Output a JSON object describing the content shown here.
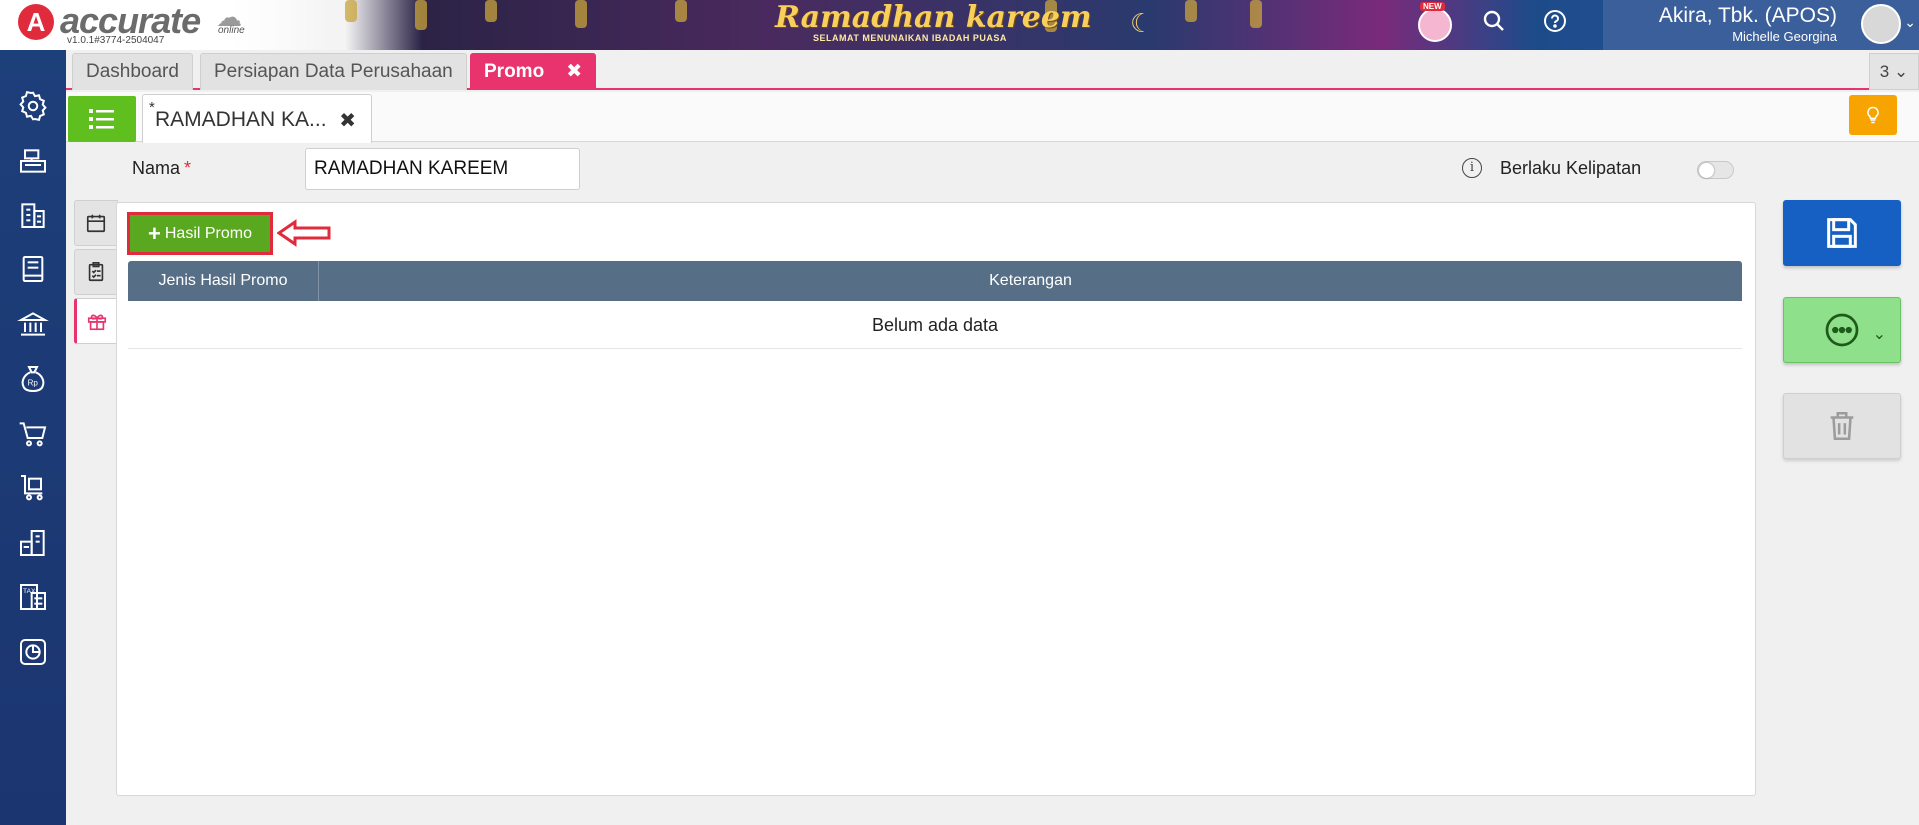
{
  "app": {
    "logo_letter": "A",
    "logo_text": "accurate",
    "logo_online": "online",
    "version": "v1.0.1#3774-2504047",
    "banner_title": "Ramadhan kareem",
    "banner_subtitle": "SELAMAT MENUNAIKAN IBADAH PUASA",
    "new_badge": "NEW",
    "user_name": "Akira, Tbk. (APOS)",
    "user_subname": "Michelle Georgina"
  },
  "tabs": {
    "items": [
      {
        "label": "Dashboard"
      },
      {
        "label": "Persiapan Data Perusahaan"
      },
      {
        "label": "Promo"
      }
    ],
    "count": "3"
  },
  "subtab": {
    "modified_mark": "*",
    "label": "RAMADHAN KA..."
  },
  "form": {
    "name_label": "Nama",
    "required_mark": "*",
    "name_value": "RAMADHAN KAREEM",
    "berlaku_label": "Berlaku Kelipatan",
    "berlaku_on": false
  },
  "panel": {
    "add_button_label": "Hasil Promo",
    "columns": [
      "Jenis Hasil Promo",
      "Keterangan"
    ],
    "empty_text": "Belum ada data"
  },
  "colors": {
    "accent": "#e8336f",
    "green": "#5aa81f",
    "save": "#1560c2",
    "table_header": "#566f87",
    "sidebar": "#1d3f7a"
  },
  "icons": {
    "sidebar": [
      "settings-icon",
      "cash-register-icon",
      "building-icon",
      "ledger-book-icon",
      "bank-icon",
      "money-bag-icon",
      "shopping-cart-icon",
      "purchase-cart-icon",
      "warehouse-icon",
      "tax-document-icon",
      "report-chart-icon"
    ]
  }
}
